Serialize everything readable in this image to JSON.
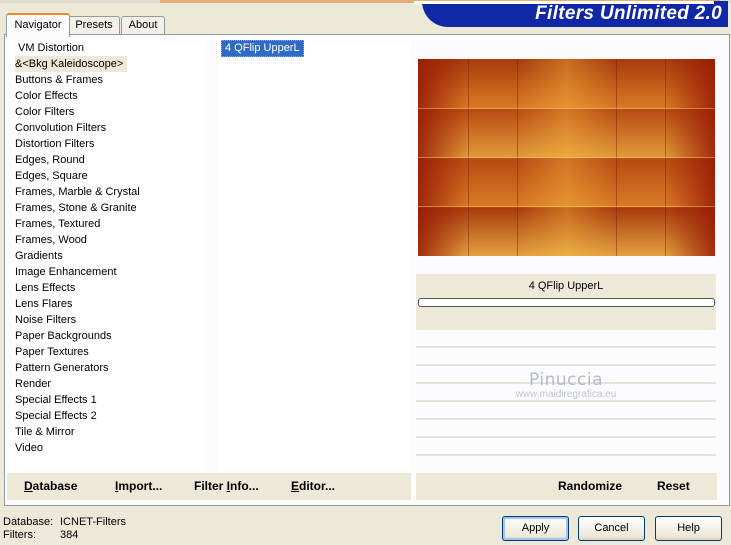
{
  "app": {
    "title": "Filters Unlimited 2.0"
  },
  "tabs": [
    {
      "label": "Navigator",
      "active": true
    },
    {
      "label": "Presets",
      "active": false
    },
    {
      "label": "About",
      "active": false
    }
  ],
  "categories": {
    "items": [
      "VM Distortion",
      "&<Bkg Kaleidoscope>",
      "Buttons & Frames",
      "Color Effects",
      "Color Filters",
      "Convolution Filters",
      "Distortion Filters",
      "Edges, Round",
      "Edges, Square",
      "Frames, Marble & Crystal",
      "Frames, Stone & Granite",
      "Frames, Textured",
      "Frames, Wood",
      "Gradients",
      "Image Enhancement",
      "Lens Effects",
      "Lens Flares",
      "Noise Filters",
      "Paper Backgrounds",
      "Paper Textures",
      "Pattern Generators",
      "Render",
      "Special Effects 1",
      "Special Effects 2",
      "Tile & Mirror",
      "Video"
    ],
    "selected": "&<Bkg Kaleidoscope>"
  },
  "filters": {
    "items": [
      "4 QFlip UpperL"
    ],
    "selected": "4 QFlip UpperL"
  },
  "preview": {
    "filter_name": "4 QFlip UpperL",
    "colors": {
      "dark": "#a83a0c",
      "light": "#e3a040"
    }
  },
  "watermark": {
    "name": "Pinuccia",
    "url": "www.maidiregrafica.eu"
  },
  "toolbar": {
    "database": "Database",
    "import": "Import...",
    "filter_info": "Filter Info...",
    "editor": "Editor...",
    "randomize": "Randomize",
    "reset": "Reset"
  },
  "status": {
    "database_label": "Database:",
    "database_value": "ICNET-Filters",
    "filters_label": "Filters:",
    "filters_value": "384"
  },
  "dialog": {
    "apply": "Apply",
    "cancel": "Cancel",
    "help": "Help"
  },
  "colors": {
    "accent_tab": "#e68b2c",
    "banner": "#1027a6",
    "selection": "#316ac5"
  }
}
